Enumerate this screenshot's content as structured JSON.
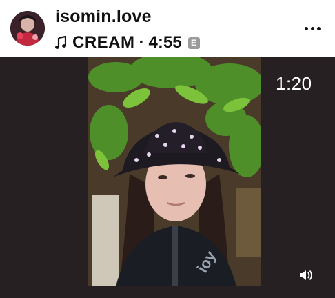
{
  "post": {
    "username": "isomin.love",
    "music": {
      "song": "CREAM",
      "separator": "·",
      "duration": "4:55",
      "explicit_badge": "E"
    },
    "icons": {
      "avatar": "profile-avatar",
      "music": "music-note-icon",
      "more": "more-options-icon",
      "volume": "volume-on-icon"
    }
  },
  "video": {
    "elapsed": "1:20"
  },
  "colors": {
    "header_bg": "#ffffff",
    "text": "#111111",
    "video_letterbox": "#262022",
    "explicit_badge": "#9b9b9b"
  }
}
